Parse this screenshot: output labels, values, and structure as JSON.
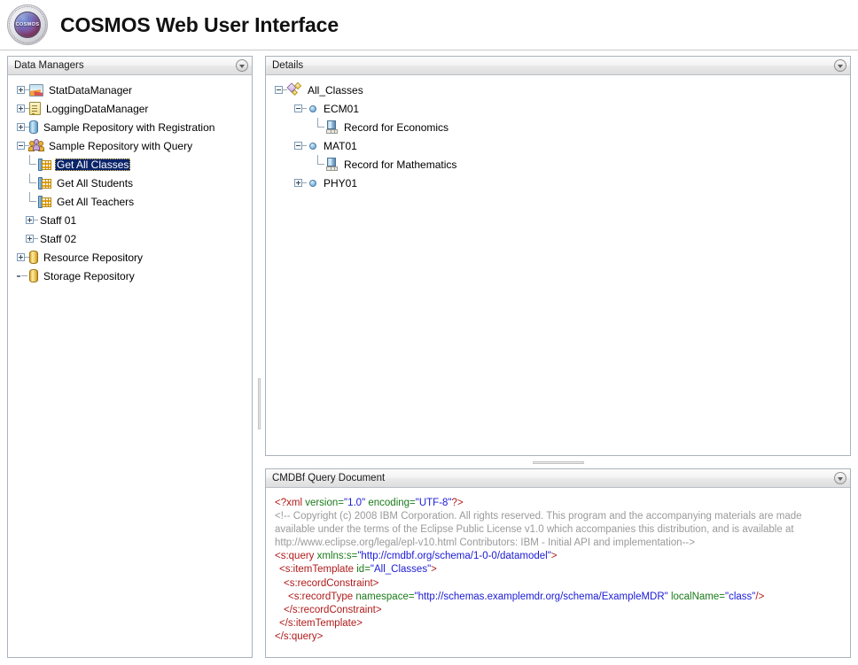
{
  "header": {
    "title": "COSMOS Web User Interface",
    "logo_label": "COSMOS",
    "logo_icon": "cosmos-orb-logo"
  },
  "panels": {
    "data_managers": {
      "title": "Data Managers",
      "collapse_icon": "chevron-down-circle-icon"
    },
    "details": {
      "title": "Details",
      "collapse_icon": "chevron-down-circle-icon"
    },
    "cmdbf": {
      "title": "CMDBf Query Document",
      "collapse_icon": "chevron-down-circle-icon"
    }
  },
  "data_managers_tree": [
    {
      "label": "StatDataManager",
      "icon": "stat-chart-icon",
      "state": "collapsed",
      "depth": 0,
      "selected": false
    },
    {
      "label": "LoggingDataManager",
      "icon": "log-document-icon",
      "state": "collapsed",
      "depth": 0,
      "selected": false
    },
    {
      "label": "Sample Repository with Registration",
      "icon": "blue-cylinder-icon",
      "state": "collapsed",
      "depth": 0,
      "selected": false
    },
    {
      "label": "Sample Repository with Query",
      "icon": "user-group-icon",
      "state": "expanded",
      "depth": 0,
      "selected": false
    },
    {
      "label": "Get All Classes",
      "icon": "query-table-icon",
      "state": "leaf",
      "depth": 1,
      "selected": true
    },
    {
      "label": "Get All Students",
      "icon": "query-table-icon",
      "state": "leaf",
      "depth": 1,
      "selected": false
    },
    {
      "label": "Get All Teachers",
      "icon": "query-table-icon",
      "state": "leaf",
      "depth": 1,
      "selected": false
    },
    {
      "label": "Staff 01",
      "icon": "none",
      "state": "collapsed",
      "depth": 1,
      "selected": false
    },
    {
      "label": "Staff 02",
      "icon": "none",
      "state": "collapsed",
      "depth": 1,
      "selected": false
    },
    {
      "label": "Resource Repository",
      "icon": "gold-cylinder-icon",
      "state": "collapsed",
      "depth": 0,
      "selected": false
    },
    {
      "label": "Storage Repository",
      "icon": "gold-cylinder-icon",
      "state": "leaf-root",
      "depth": 0,
      "selected": false
    }
  ],
  "details_tree": [
    {
      "label": "All_Classes",
      "icon": "sparkle-diamond-icon",
      "state": "expanded",
      "depth": 0
    },
    {
      "label": "ECM01",
      "icon": "blue-sphere-icon",
      "state": "expanded",
      "depth": 1
    },
    {
      "label": "Record for Economics",
      "icon": "record-icon",
      "state": "leaf",
      "depth": 2
    },
    {
      "label": "MAT01",
      "icon": "blue-sphere-icon",
      "state": "expanded",
      "depth": 1
    },
    {
      "label": "Record for Mathematics",
      "icon": "record-icon",
      "state": "leaf",
      "depth": 2
    },
    {
      "label": "PHY01",
      "icon": "blue-sphere-icon",
      "state": "collapsed",
      "depth": 1
    }
  ],
  "cmdbf_document": {
    "lines": [
      {
        "indent": 0,
        "parts": [
          {
            "t": "tag",
            "s": "<?xml "
          },
          {
            "t": "attr",
            "s": "version="
          },
          {
            "t": "val",
            "s": "\"1.0\" "
          },
          {
            "t": "attr",
            "s": "encoding="
          },
          {
            "t": "val",
            "s": "\"UTF-8\""
          },
          {
            "t": "tag",
            "s": "?>"
          }
        ]
      },
      {
        "indent": 0,
        "parts": [
          {
            "t": "comment",
            "s": "<!-- Copyright (c) 2008 IBM Corporation. All rights reserved. This program and the accompanying materials are made available under the terms of the Eclipse Public License v1.0 which accompanies this distribution, and is available at http://www.eclipse.org/legal/epl-v10.html Contributors: IBM - Initial API and implementation-->"
          }
        ]
      },
      {
        "indent": 0,
        "parts": [
          {
            "t": "tag",
            "s": "<s:query "
          },
          {
            "t": "attr",
            "s": "xmlns:s="
          },
          {
            "t": "val",
            "s": "\"http://cmdbf.org/schema/1-0-0/datamodel\""
          },
          {
            "t": "tag",
            "s": ">"
          }
        ]
      },
      {
        "indent": 1,
        "parts": [
          {
            "t": "tag",
            "s": "<s:itemTemplate "
          },
          {
            "t": "attr",
            "s": "id="
          },
          {
            "t": "val",
            "s": "\"All_Classes\""
          },
          {
            "t": "tag",
            "s": ">"
          }
        ]
      },
      {
        "indent": 2,
        "parts": [
          {
            "t": "tag",
            "s": "<s:recordConstraint>"
          }
        ]
      },
      {
        "indent": 3,
        "parts": [
          {
            "t": "tag",
            "s": "<s:recordType "
          },
          {
            "t": "attr",
            "s": "namespace="
          },
          {
            "t": "val",
            "s": "\"http://schemas.examplemdr.org/schema/ExampleMDR\" "
          },
          {
            "t": "attr",
            "s": "localName="
          },
          {
            "t": "val",
            "s": "\"class\""
          },
          {
            "t": "tag",
            "s": "/>"
          }
        ]
      },
      {
        "indent": 2,
        "parts": [
          {
            "t": "tag",
            "s": "</s:recordConstraint>"
          }
        ]
      },
      {
        "indent": 1,
        "parts": [
          {
            "t": "tag",
            "s": "</s:itemTemplate>"
          }
        ]
      },
      {
        "indent": 0,
        "parts": [
          {
            "t": "tag",
            "s": "</s:query>"
          }
        ]
      }
    ]
  },
  "colors": {
    "selection_bg": "#0a246a",
    "selection_fg": "#ffffff",
    "panel_border": "#a9b3bd",
    "xml_tag": "#b01a1a",
    "xml_attr": "#1a7a1a",
    "xml_value": "#1a1ad6",
    "xml_comment": "#9a9a9a"
  }
}
